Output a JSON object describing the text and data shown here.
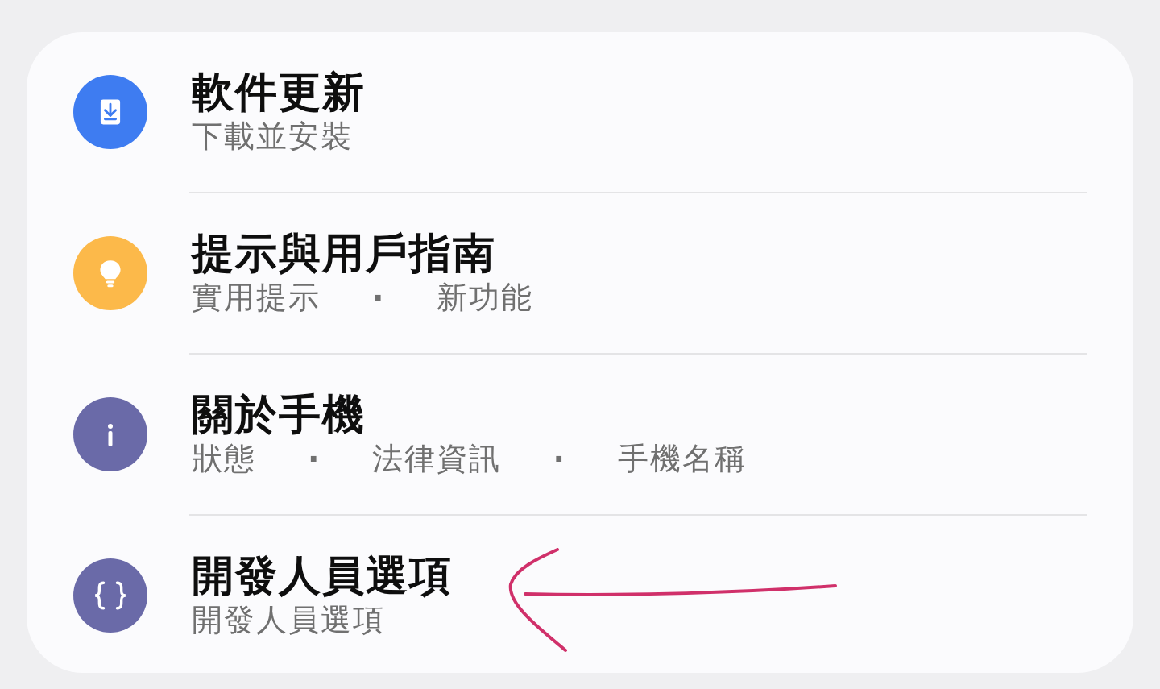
{
  "items": [
    {
      "kind": "download",
      "color": "#3e7cf1",
      "title": "軟件更新",
      "subtitle": [
        "下載並安裝"
      ]
    },
    {
      "kind": "bulb",
      "color": "#fcb94a",
      "title": "提示與用戶指南",
      "subtitle": [
        "實用提示",
        "·",
        "新功能"
      ]
    },
    {
      "kind": "info",
      "color": "#6a6aa8",
      "title": "關於手機",
      "subtitle": [
        "狀態",
        "·",
        "法律資訊",
        "·",
        "手機名稱"
      ]
    },
    {
      "kind": "braces",
      "color": "#6a6aa8",
      "title": "開發人員選項",
      "subtitle": [
        "開發人員選項"
      ]
    }
  ],
  "annotation": {
    "kind": "arrow",
    "color": "#d0306a"
  }
}
